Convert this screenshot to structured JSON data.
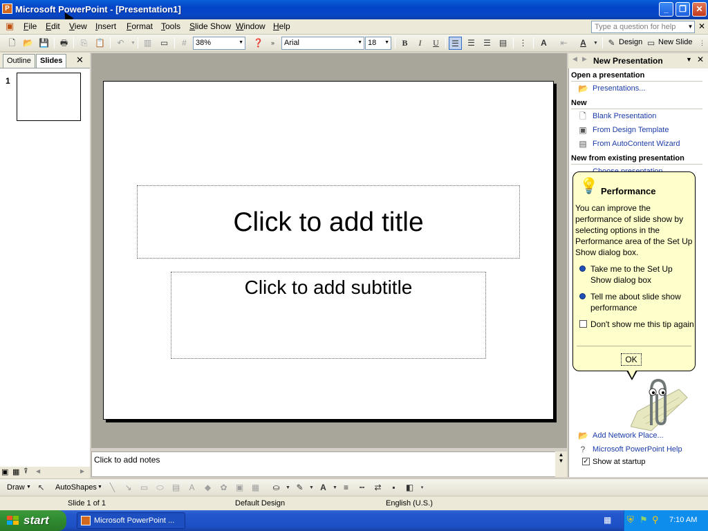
{
  "window": {
    "title": "Microsoft PowerPoint - [Presentation1]",
    "app_icon": "powerpoint-icon",
    "controls": [
      "minimize-icon",
      "restore-icon",
      "close-icon"
    ]
  },
  "menubar": {
    "items": [
      "File",
      "Edit",
      "View",
      "Insert",
      "Format",
      "Tools",
      "Slide Show",
      "Window",
      "Help"
    ],
    "help_placeholder": "Type a question for help"
  },
  "toolbar": {
    "zoom": "38%",
    "font": "Arial",
    "font_size": "18",
    "bold": "B",
    "italic": "I",
    "underline": "U",
    "design_label": "Design",
    "new_slide_label": "New Slide"
  },
  "left_pane": {
    "tabs": [
      "Outline",
      "Slides"
    ],
    "active_tab": "Slides",
    "slide_number": "1"
  },
  "slide": {
    "title_placeholder": "Click to add title",
    "subtitle_placeholder": "Click to add subtitle"
  },
  "notes": {
    "placeholder": "Click to add notes"
  },
  "task_pane": {
    "title": "New Presentation",
    "open_header": "Open a presentation",
    "open_link": "Presentations...",
    "new_header": "New",
    "new_links": [
      "Blank Presentation",
      "From Design Template",
      "From AutoContent Wizard"
    ],
    "existing_header": "New from existing presentation",
    "existing_link": "Choose presentation...",
    "bottom_links": [
      "Add Network Place...",
      "Microsoft PowerPoint Help"
    ],
    "show_startup": "Show at startup",
    "show_startup_checked": true
  },
  "balloon": {
    "title": "Performance",
    "text": "You can improve the performance of slide show by selecting options in the Performance area of the Set Up Show dialog box.",
    "options": [
      "Take me to the Set Up Show dialog box",
      "Tell me about slide show performance"
    ],
    "checkbox": "Don't show me this tip again",
    "ok": "OK"
  },
  "drawbar": {
    "draw": "Draw",
    "autoshapes": "AutoShapes"
  },
  "statusbar": {
    "slide": "Slide 1 of 1",
    "design": "Default Design",
    "language": "English (U.S.)"
  },
  "taskbar": {
    "start": "start",
    "task": "Microsoft PowerPoint ...",
    "clock": "7:10 AM"
  },
  "colors": {
    "title_bar": "#0343c7",
    "taskbar": "#2456cc",
    "start_button": "#2f8a2f",
    "link": "#1b3ca8",
    "balloon": "#ffffcc"
  }
}
